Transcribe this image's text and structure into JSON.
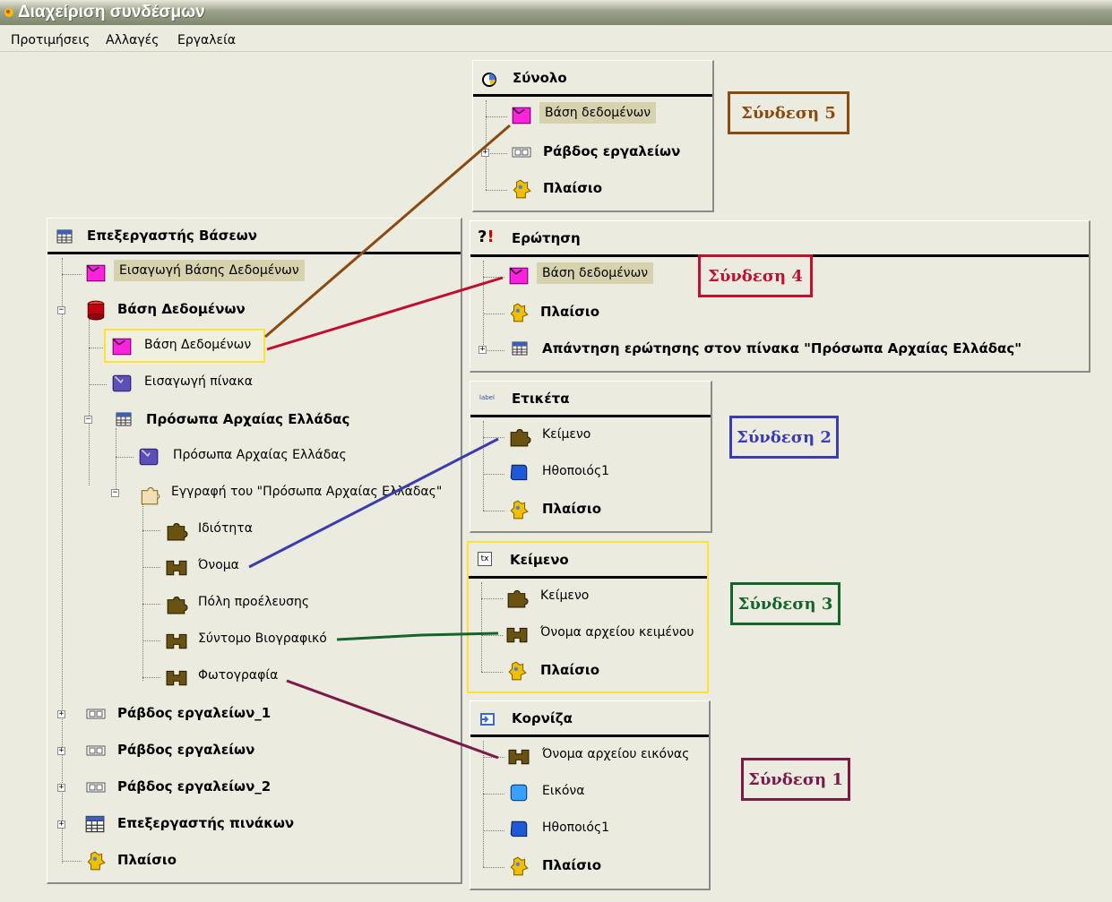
{
  "window": {
    "title": "Διαχείριση συνδέσμων"
  },
  "menu": [
    "Προτιμήσεις",
    "Αλλαγές",
    "Εργαλεία"
  ],
  "colors": {
    "link1": "#7a1a4a",
    "link2": "#3c3cb0",
    "link3": "#15642a",
    "link4": "#c01030",
    "link5": "#8a4a10",
    "selection": "#ffe135",
    "highlight": "#d6d2ad"
  },
  "left_panel": {
    "header": "Επεξεργαστής Βάσεων",
    "items": [
      "Εισαγωγή Βάσης Δεδομένων",
      "Βάση Δεδομένων",
      "Βάση Δεδομένων",
      "Εισαγωγή πίνακα",
      "Πρόσωπα Αρχαίας Ελλάδας",
      "Πρόσωπα Αρχαίας Ελλάδας",
      "Εγγραφή του \"Πρόσωπα Αρχαίας Ελλάδας\"",
      "Ιδιότητα",
      "Όνομα",
      "Πόλη προέλευσης",
      "Σύντομο Βιογραφικό",
      "Φωτογραφία",
      "Ράβδος εργαλείων_1",
      "Ράβδος εργαλείων",
      "Ράβδος εργαλείων_2",
      "Επεξεργαστής πινάκων",
      "Πλαίσιο"
    ]
  },
  "panel_synolo": {
    "header": "Σύνολο",
    "items": [
      "Βάση δεδομένων",
      "Ράβδος εργαλείων",
      "Πλαίσιο"
    ]
  },
  "panel_erotisi": {
    "header": "Ερώτηση",
    "items": [
      "Βάση δεδομένων",
      "Πλαίσιο",
      "Απάντηση ερώτησης στον πίνακα \"Πρόσωπα Αρχαίας Ελλάδας\""
    ]
  },
  "panel_etiketa": {
    "header": "Ετικέτα",
    "items": [
      "Κείμενο",
      "Ηθοποιός1",
      "Πλαίσιο"
    ]
  },
  "panel_keimeno": {
    "header": "Κείμενο",
    "items": [
      "Κείμενο",
      "Όνομα αρχείου κειμένου",
      "Πλαίσιο"
    ]
  },
  "panel_korniza": {
    "header": "Κορνίζα",
    "items": [
      "Όνομα αρχείου εικόνας",
      "Εικόνα",
      "Ηθοποιός1",
      "Πλαίσιο"
    ]
  },
  "callouts": [
    "Σύνδεση 5",
    "Σύνδεση 4",
    "Σύνδεση 2",
    "Σύνδεση 3",
    "Σύνδεση 1"
  ]
}
